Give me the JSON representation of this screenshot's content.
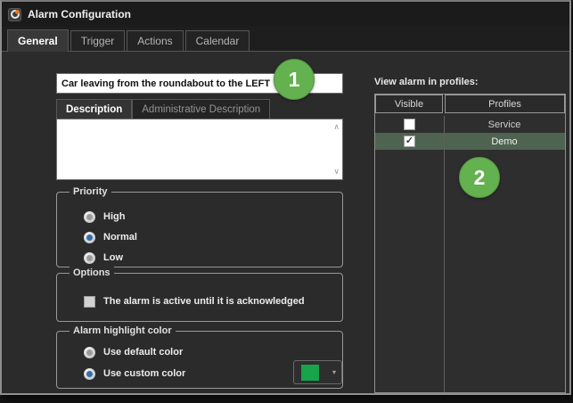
{
  "window": {
    "title": "Alarm Configuration"
  },
  "tabs": [
    {
      "label": "General",
      "active": true
    },
    {
      "label": "Trigger",
      "active": false
    },
    {
      "label": "Actions",
      "active": false
    },
    {
      "label": "Calendar",
      "active": false
    }
  ],
  "alarm_name": {
    "value": "Car leaving from the roundabout to the LEFT"
  },
  "description": {
    "tabs": [
      {
        "label": "Description",
        "active": true
      },
      {
        "label": "Administrative Description",
        "active": false
      }
    ],
    "text": ""
  },
  "priority": {
    "label": "Priority",
    "options": [
      {
        "label": "High",
        "selected": false
      },
      {
        "label": "Normal",
        "selected": true
      },
      {
        "label": "Low",
        "selected": false
      }
    ]
  },
  "options": {
    "label": "Options",
    "checkbox": {
      "label": "The alarm is active until it is acknowledged",
      "checked": false
    }
  },
  "highlight": {
    "label": "Alarm highlight color",
    "options": [
      {
        "label": "Use default color",
        "selected": false
      },
      {
        "label": "Use custom color",
        "selected": true
      }
    ],
    "custom_color": "#17a44a"
  },
  "profiles_panel": {
    "label": "View alarm in profiles:",
    "columns": [
      "Visible",
      "Profiles"
    ],
    "rows": [
      {
        "profile": "Service",
        "visible": false,
        "highlighted": false
      },
      {
        "profile": "Demo",
        "visible": true,
        "highlighted": true
      }
    ]
  },
  "annotations": [
    {
      "number": "1"
    },
    {
      "number": "2"
    }
  ],
  "colors": {
    "annotation_green": "#64b150",
    "row_highlight_green": "#4e6350",
    "swatch_green": "#17a44a",
    "selected_radio_blue": "#2f6fae",
    "titlebar_bg": "#1b1b1b",
    "content_bg": "#2b2b2b"
  }
}
